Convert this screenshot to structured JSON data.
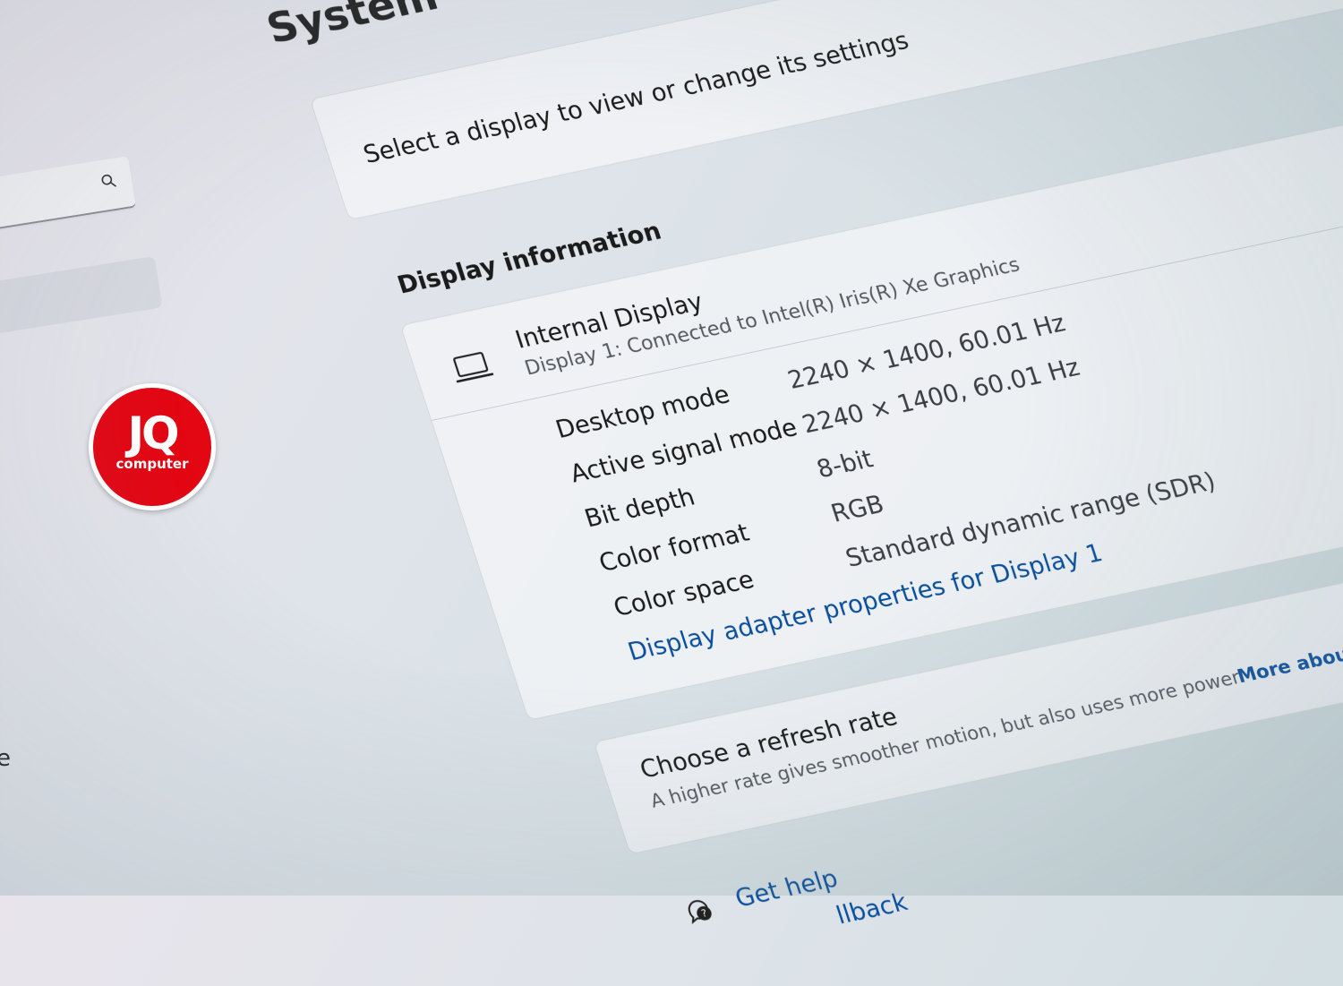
{
  "page": {
    "title": "System"
  },
  "sidebar": {
    "search_placeholder": "",
    "edge_text": "e"
  },
  "logo": {
    "big": "JQ",
    "small": "computer"
  },
  "display_select": {
    "prompt": "Select a display to view or change its settings"
  },
  "display_info": {
    "section_title": "Display information",
    "display_name": "Internal Display",
    "display_subtitle": "Display 1: Connected to Intel(R) Iris(R) Xe Graphics",
    "rows": [
      {
        "label": "Desktop mode",
        "value": "2240 × 1400, 60.01 Hz"
      },
      {
        "label": "Active signal mode",
        "value": "2240 × 1400, 60.01 Hz"
      },
      {
        "label": "Bit depth",
        "value": "8-bit"
      },
      {
        "label": "Color format",
        "value": "RGB"
      },
      {
        "label": "Color space",
        "value": "Standard dynamic range (SDR)"
      }
    ],
    "adapter_link": "Display adapter properties for Display 1"
  },
  "refresh_rate": {
    "title": "Choose a refresh rate",
    "subtitle": "A higher rate gives smoother motion, but also uses more power",
    "link": "More about refresh rate"
  },
  "help": {
    "get_help": "Get help",
    "feedback": "llback"
  },
  "colors": {
    "accent": "#0a4f9c",
    "logo_red": "#e30613"
  },
  "icons": [
    "search-icon",
    "laptop-icon",
    "help-icon"
  ]
}
